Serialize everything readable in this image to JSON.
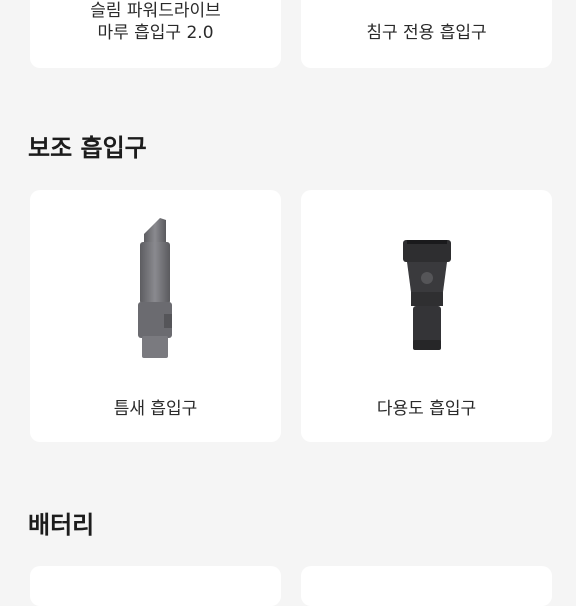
{
  "top_row": {
    "items": [
      {
        "label_line1": "슬림 파워드라이브",
        "label_line2": "마루 흡입구 2.0"
      },
      {
        "label_line1": "침구 전용 흡입구",
        "label_line2": ""
      }
    ]
  },
  "sections": [
    {
      "title": "보조 흡입구",
      "items": [
        {
          "label": "틈새 흡입구",
          "icon": "crevice-tool-icon"
        },
        {
          "label": "다용도 흡입구",
          "icon": "combination-tool-icon"
        }
      ]
    },
    {
      "title": "배터리",
      "items": []
    }
  ],
  "colors": {
    "page_bg": "#f5f5f5",
    "card_bg": "#ffffff",
    "tool_grey": "#6f6f73",
    "tool_black": "#2b2b2b"
  }
}
